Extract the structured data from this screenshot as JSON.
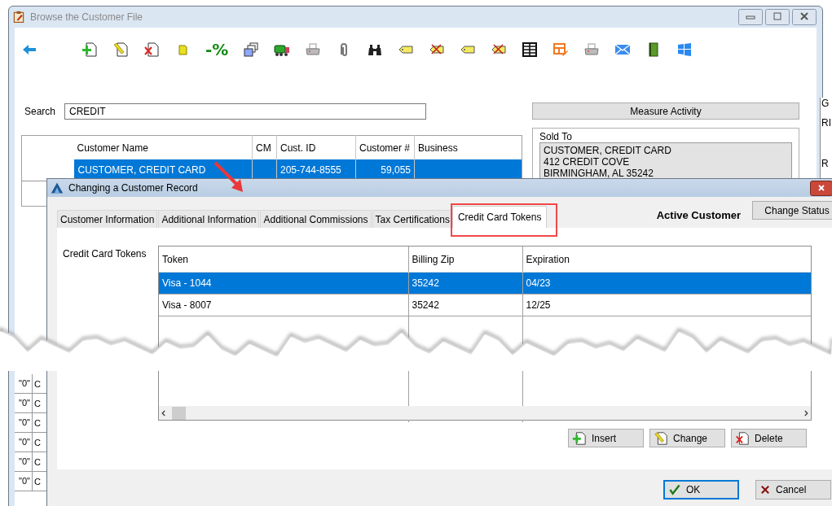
{
  "browse_window": {
    "title": "Browse the Customer File"
  },
  "toolbar": [
    {
      "kind": "back"
    },
    {
      "kind": "doc-add"
    },
    {
      "kind": "doc-edit"
    },
    {
      "kind": "doc-delete"
    },
    {
      "kind": "note"
    },
    {
      "kind": "text",
      "label": "-%"
    },
    {
      "kind": "windows"
    },
    {
      "kind": "truck"
    },
    {
      "kind": "printer"
    },
    {
      "kind": "paperclip"
    },
    {
      "kind": "binoculars"
    },
    {
      "kind": "tag"
    },
    {
      "kind": "tag-x"
    },
    {
      "kind": "tag"
    },
    {
      "kind": "tag-x"
    },
    {
      "kind": "grid"
    },
    {
      "kind": "table-pen"
    },
    {
      "kind": "printer"
    },
    {
      "kind": "envelope"
    },
    {
      "kind": "book"
    },
    {
      "kind": "windows-logo"
    }
  ],
  "search": {
    "label": "Search",
    "value": "CREDIT"
  },
  "measure_button": "Measure Activity",
  "customer_table": {
    "columns": [
      "Customer Name",
      "CM",
      "Cust. ID",
      "Customer #",
      "Business"
    ],
    "rows": [
      {
        "customer_name": "CUSTOMER, CREDIT CARD",
        "cust_id": "205-744-8555",
        "customer_no": "59,055",
        "selected": true
      }
    ]
  },
  "sold_to": {
    "label": "Sold To",
    "lines": [
      "CUSTOMER, CREDIT CARD",
      "412 CREDIT COVE",
      "BIRMINGHAM, AL 35242"
    ]
  },
  "background_rows": [
    {
      "column_1": "\"0\"",
      "column_2": "C"
    },
    {
      "column_1": "\"0\"",
      "column_2": "C"
    },
    {
      "column_1": "\"0\"",
      "column_2": "C"
    },
    {
      "column_1": "\"0\"",
      "column_2": "C"
    },
    {
      "column_1": "\"0\"",
      "column_2": "C"
    },
    {
      "column_1": "\"0\"",
      "column_2": "C"
    }
  ],
  "right_edge_fragments": [
    "G",
    "RI",
    "R"
  ],
  "dialog": {
    "title": "Changing a Customer Record",
    "tabs": [
      {
        "label": "Customer Information",
        "selected": false
      },
      {
        "label": "Additional Information",
        "selected": false
      },
      {
        "label": "Additional Commissions",
        "selected": false
      },
      {
        "label": "Tax Certifications",
        "selected": false
      },
      {
        "label": "Credit Card Tokens",
        "selected": true
      }
    ],
    "status": "Active Customer",
    "change_status_button": "Change Status",
    "tokens_label": "Credit Card Tokens",
    "tokens_table": {
      "columns": [
        "Token",
        "Billing Zip",
        "Expiration"
      ],
      "rows": [
        {
          "token": "Visa - 1044",
          "billing_zip": "35242",
          "expiration": "04/23",
          "selected": true
        },
        {
          "token": "Visa - 8007",
          "billing_zip": "35242",
          "expiration": "12/25",
          "selected": false
        }
      ]
    },
    "buttons": [
      {
        "kind": "insert",
        "label": "Insert"
      },
      {
        "kind": "change",
        "label": "Change"
      },
      {
        "kind": "delete",
        "label": "Delete"
      }
    ],
    "ok": "OK",
    "cancel": "Cancel"
  }
}
